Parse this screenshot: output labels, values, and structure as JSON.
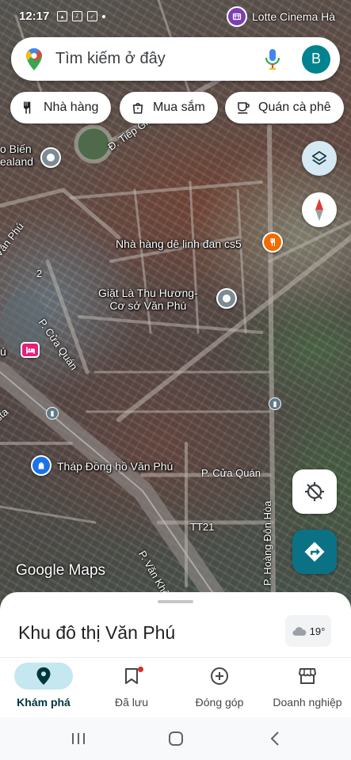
{
  "status_bar": {
    "time": "12:17",
    "app_icons": [
      "gallery-icon",
      "zalo-icon",
      "check-icon"
    ]
  },
  "map": {
    "top_poi": "Lotte Cinema Hà",
    "labels": {
      "bien_lealand": "o Biến\nealand",
      "nha_hang": "Nhà hàng dê linh đan cs5",
      "giat_la": "Giặt Là Thu Hương-\nCơ sở Văn Phú",
      "thap_dong_ho": "Tháp Đồng hồ Văn Phú",
      "hotel_left": "ú"
    },
    "roads": {
      "tiep_giap": "Đ. Tiếp Giáp Cả",
      "van_phu_left": "Văn Phú",
      "cua_quan_diag": "P. Cửa Quán",
      "cua_quan_h": "P. Cửa Quán",
      "hoang_don_hoa": "P. Hoàng Đôn Hòa",
      "tt21": "TT21",
      "van_khe": "P. Văn Khê",
      "num_2": "2",
      "sta": "sta"
    },
    "google_logo": "Google Maps"
  },
  "search": {
    "placeholder": "Tìm kiếm ở đây",
    "avatar_letter": "B"
  },
  "chips": [
    {
      "label": "Nhà hàng",
      "icon": "fork-knife-icon"
    },
    {
      "label": "Mua sắm",
      "icon": "shopping-bag-icon"
    },
    {
      "label": "Quán cà phê",
      "icon": "coffee-cup-icon"
    }
  ],
  "sheet": {
    "place_name": "Khu đô thị Văn Phú",
    "temperature": "19°",
    "weather_icon": "cloud-icon"
  },
  "nav": [
    {
      "label": "Khám phá",
      "icon": "location-pin-icon",
      "active": true
    },
    {
      "label": "Đã lưu",
      "icon": "bookmark-icon",
      "active": false,
      "badge": true
    },
    {
      "label": "Đóng góp",
      "icon": "add-circle-icon",
      "active": false
    },
    {
      "label": "Doanh nghiệp",
      "icon": "storefront-icon",
      "active": false
    }
  ],
  "colors": {
    "accent": "#0b7285",
    "active_pill": "#c5e7ef",
    "avatar": "#00838f",
    "badge": "#d93025"
  }
}
